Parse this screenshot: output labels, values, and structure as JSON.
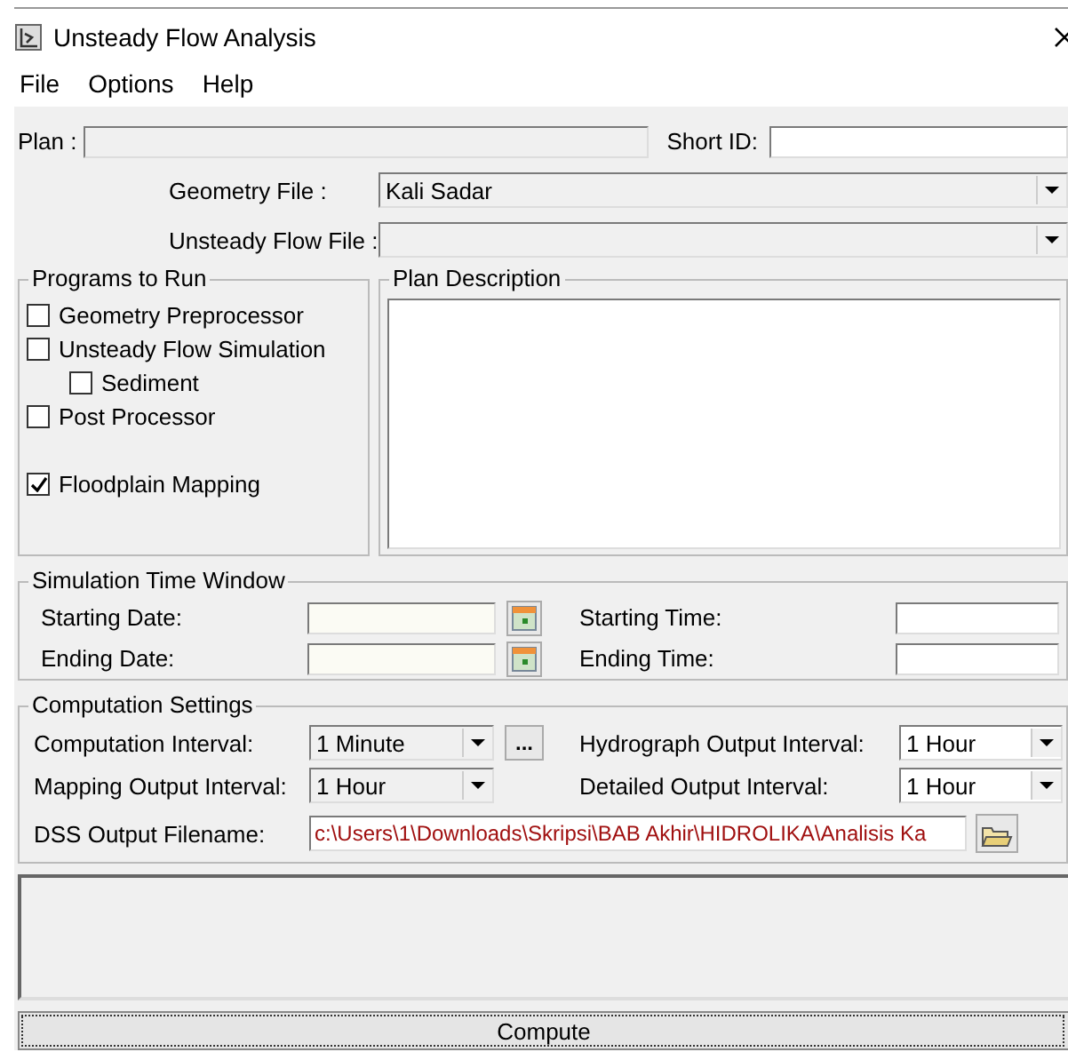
{
  "window": {
    "title": "Unsteady Flow Analysis"
  },
  "menu": [
    "File",
    "Options",
    "Help"
  ],
  "plan": {
    "label": "Plan :"
  },
  "short_id": {
    "label": "Short ID:"
  },
  "geometry_file": {
    "label": "Geometry File :",
    "value": "Kali Sadar"
  },
  "unsteady_flow_file": {
    "label": "Unsteady Flow File :"
  },
  "programs_to_run": {
    "title": "Programs to Run",
    "items": [
      {
        "label": "Geometry Preprocessor",
        "checked": false
      },
      {
        "label": "Unsteady Flow Simulation",
        "checked": false,
        "children": [
          {
            "label": "Sediment",
            "checked": false
          }
        ]
      },
      {
        "label": "Post Processor",
        "checked": false
      },
      {
        "label": "Floodplain Mapping",
        "checked": true
      }
    ]
  },
  "plan_description": {
    "title": "Plan Description"
  },
  "simulation_time_window": {
    "title": "Simulation Time Window",
    "rows": [
      {
        "date_label": "Starting Date:",
        "time_label": "Starting Time:"
      },
      {
        "date_label": "Ending Date:",
        "time_label": "Ending Time:"
      }
    ]
  },
  "computation_settings": {
    "title": "Computation Settings",
    "rows": [
      {
        "left_label": "Computation Interval:",
        "left_value": "1 Minute",
        "more": "...",
        "right_label": "Hydrograph Output Interval:",
        "right_value": "1 Hour"
      },
      {
        "left_label": "Mapping Output Interval:",
        "left_value": "1 Hour",
        "right_label": "Detailed Output Interval:",
        "right_value": "1 Hour"
      }
    ],
    "dss_output": {
      "label": "DSS Output Filename:",
      "value": "c:\\Users\\1\\Downloads\\Skripsi\\BAB Akhir\\HIDROLIKA\\Analisis Ka"
    }
  },
  "compute_button": "Compute"
}
